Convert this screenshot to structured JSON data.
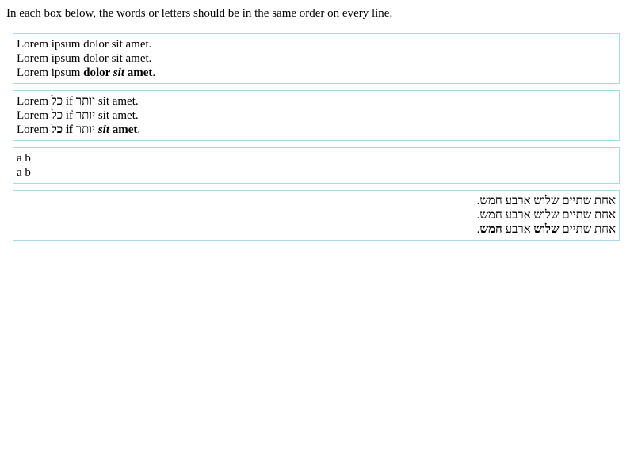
{
  "intro": "In each box below, the words or letters should be in the same order on every line.",
  "box1": {
    "line1": "Lorem ipsum dolor sit amet.",
    "line2": "Lorem ipsum dolor sit amet.",
    "line3": {
      "w1": "Lorem ipsum ",
      "w2": "dolor",
      "w3": " ",
      "w4": "sit",
      "w5": " ",
      "w6": "amet",
      "w7": "."
    }
  },
  "box2": {
    "line1": "Lorem כל if יותר sit amet.",
    "line2": "Lorem כל if יותר sit amet.",
    "line3": {
      "w1": "Lorem ",
      "w2": "כל",
      "w3": " ",
      "w4": "if",
      "w5": " יותר ",
      "w6": "sit",
      "w7": " ",
      "w8": "amet",
      "w9": "."
    }
  },
  "box3": {
    "line1": "a b",
    "line2": "a b"
  },
  "box4": {
    "line1": "אחת שתיים שלוש ארבע חמש.",
    "line2": "אחת שתיים שלוש ארבע חמש.",
    "line3": {
      "w1": "אחת שתיים ",
      "w2": "שלוש",
      "w3": " ארבע ",
      "w4": "חמש",
      "w5": "."
    }
  }
}
